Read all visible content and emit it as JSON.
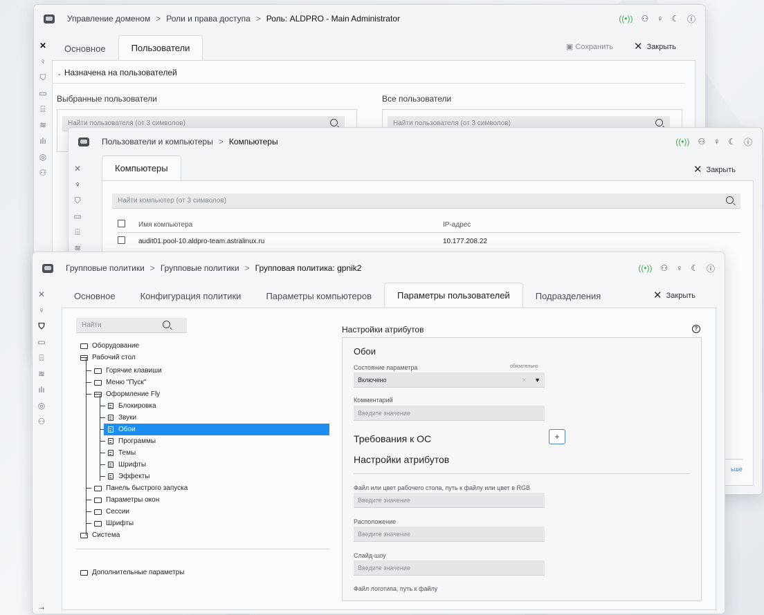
{
  "win_role": {
    "breadcrumb": [
      "Управление доменом",
      "Роли и права доступа",
      "Роль: ALDPRO - Main Administrator"
    ],
    "tabs": [
      "Основное",
      "Пользователи"
    ],
    "save_label": "Сохранить",
    "close_label": "Закрыть",
    "section_title": "Назначена на пользователей",
    "selected_users_title": "Выбранные пользователи",
    "all_users_title": "Все пользователи",
    "search_placeholder": "Найти пользователя (от 3 символов)"
  },
  "win_computers": {
    "breadcrumb": [
      "Пользователи и компьютеры",
      "Компьютеры"
    ],
    "tab": "Компьютеры",
    "close_label": "Закрыть",
    "search_placeholder": "Найти компьютер (от 3 символов)",
    "columns": [
      "Имя компьютера",
      "IP-адрес"
    ],
    "rows": [
      {
        "name": "audit01.pool-10.aldpro-team.astralinux.ru",
        "ip": "10.177.208.22"
      }
    ],
    "more_fragment": "ьше"
  },
  "win_gpo": {
    "breadcrumb": [
      "Групповые политики",
      "Групповые политики",
      "Групповая политика: gpnik2"
    ],
    "tabs": [
      "Основное",
      "Конфигурация политики",
      "Параметры компьютеров",
      "Параметры пользователей",
      "Подразделения"
    ],
    "close_label": "Закрыть",
    "search_placeholder": "Найти",
    "tree": {
      "equipment": "Оборудование",
      "desktop": "Рабочий стол",
      "hotkeys": "Горячие клавиши",
      "start_menu": "Меню \"Пуск\"",
      "fly": "Оформление Fly",
      "lock": "Блокировка",
      "sounds": "Звуки",
      "wallpaper": "Обои",
      "programs": "Программы",
      "themes": "Темы",
      "fonts": "Шрифты",
      "effects": "Эффекты",
      "quick_launch": "Панель быстрого запуска",
      "window_params": "Параметры окон",
      "sessions": "Сессии",
      "fonts2": "Шрифты",
      "system": "Система",
      "extra": "Дополнительные параметры"
    },
    "settings_title": "Настройки атрибутов",
    "card_title": "Обои",
    "state_label": "Состояние параметра",
    "required_label": "обязательно",
    "state_value": "Включено",
    "comment_label": "Комментарий",
    "placeholder": "Введите значение",
    "os_title": "Требования к ОС",
    "plus_label": "+",
    "attr_title": "Настройки атрибутов",
    "file_label": "Файл или цвет рабочего стола, путь к файлу или цвет в RGB",
    "position_label": "Расположение",
    "slideshow_label": "Слайд-шоу",
    "logo_label": "Файл логотипа, путь к файлу"
  }
}
